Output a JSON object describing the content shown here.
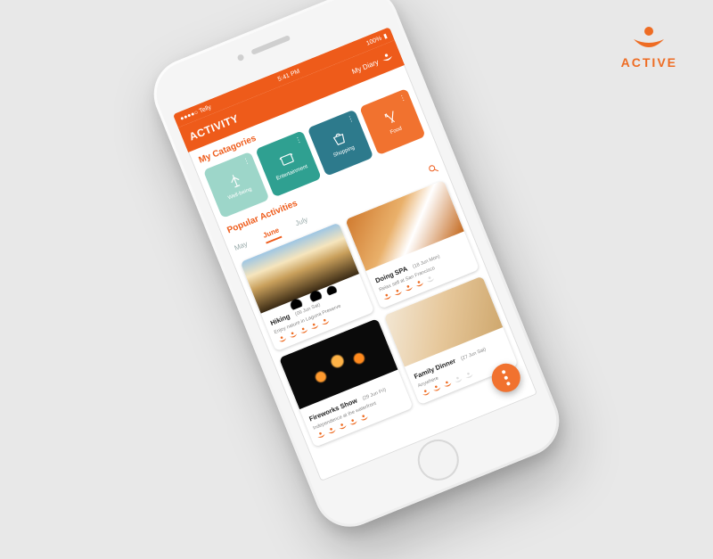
{
  "brand": {
    "name": "ACTIVE"
  },
  "statusbar": {
    "carrier": "●●●●○ Telly",
    "time": "5:41 PM",
    "battery": "100%"
  },
  "header": {
    "title": "ACTIVITY",
    "my_diary": "My Diary"
  },
  "sections": {
    "categories_title": "My Catagories",
    "popular_title": "Popular Activities"
  },
  "categories": [
    {
      "label": "Well-being"
    },
    {
      "label": "Entertainment"
    },
    {
      "label": "Shopping"
    },
    {
      "label": "Food"
    }
  ],
  "tabs": {
    "items": [
      "May",
      "June",
      "July"
    ],
    "active_index": 1
  },
  "activities": [
    {
      "name": "Hiking",
      "date": "(09 Jun Sat)",
      "sub": "Enjoy nature in Laguna Preserve"
    },
    {
      "name": "Doing SPA",
      "date": "(18 Jun Mon)",
      "sub": "Relax self at San Francisco"
    },
    {
      "name": "Fireworks Show",
      "date": "(29 Jun Fri)",
      "sub": "Independence at the waterfront"
    },
    {
      "name": "Family Dinner",
      "date": "(27 Jun Sat)",
      "sub": "Anywhere"
    }
  ],
  "colors": {
    "accent": "#ee5b1a",
    "accent2": "#f1722f"
  }
}
